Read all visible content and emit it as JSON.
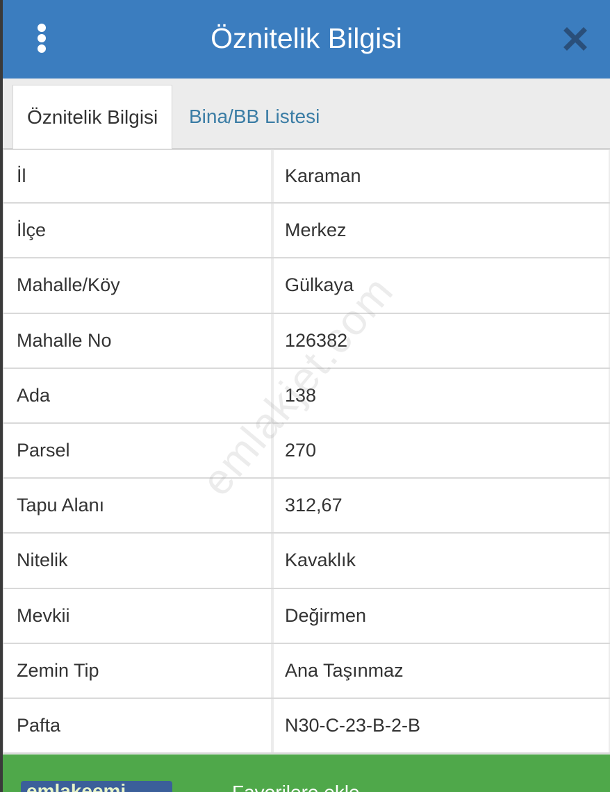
{
  "header": {
    "title": "Öznitelik Bilgisi",
    "menu_icon": "kebab-menu-icon",
    "close_icon": "close-icon",
    "color": "#3b7dbf"
  },
  "tabs": [
    {
      "label": "Öznitelik Bilgisi",
      "active": true
    },
    {
      "label": "Bina/BB Listesi",
      "active": false
    }
  ],
  "attributes": [
    {
      "key": "İl",
      "value": "Karaman"
    },
    {
      "key": "İlçe",
      "value": "Merkez"
    },
    {
      "key": "Mahalle/Köy",
      "value": "Gülkaya"
    },
    {
      "key": "Mahalle No",
      "value": "126382"
    },
    {
      "key": "Ada",
      "value": "138"
    },
    {
      "key": "Parsel",
      "value": "270"
    },
    {
      "key": "Tapu Alanı",
      "value": "312,67"
    },
    {
      "key": "Nitelik",
      "value": "Kavaklık"
    },
    {
      "key": "Mevkii",
      "value": "Değirmen"
    },
    {
      "key": "Zemin Tip",
      "value": "Ana Taşınmaz"
    },
    {
      "key": "Pafta",
      "value": "N30-C-23-B-2-B"
    }
  ],
  "footer": {
    "logo_text": "emlakeemi",
    "text": "Favorilere ekle",
    "color": "#4fa84a"
  },
  "watermark": "emlakjet.com"
}
